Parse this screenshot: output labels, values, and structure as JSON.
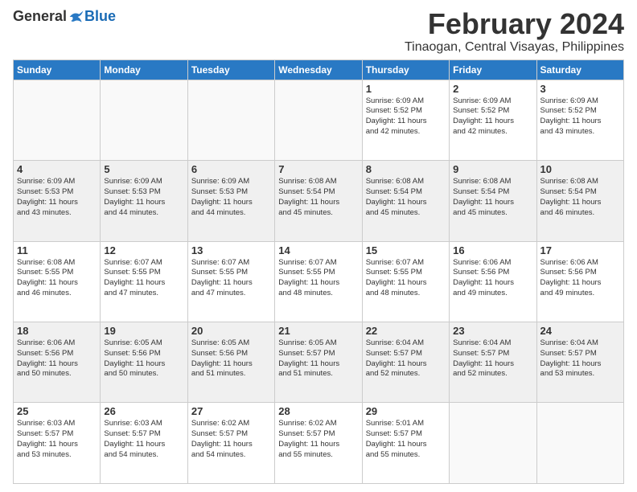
{
  "logo": {
    "general": "General",
    "blue": "Blue"
  },
  "title": "February 2024",
  "subtitle": "Tinaogan, Central Visayas, Philippines",
  "days_of_week": [
    "Sunday",
    "Monday",
    "Tuesday",
    "Wednesday",
    "Thursday",
    "Friday",
    "Saturday"
  ],
  "weeks": [
    [
      {
        "num": "",
        "info": ""
      },
      {
        "num": "",
        "info": ""
      },
      {
        "num": "",
        "info": ""
      },
      {
        "num": "",
        "info": ""
      },
      {
        "num": "1",
        "info": "Sunrise: 6:09 AM\nSunset: 5:52 PM\nDaylight: 11 hours\nand 42 minutes."
      },
      {
        "num": "2",
        "info": "Sunrise: 6:09 AM\nSunset: 5:52 PM\nDaylight: 11 hours\nand 42 minutes."
      },
      {
        "num": "3",
        "info": "Sunrise: 6:09 AM\nSunset: 5:52 PM\nDaylight: 11 hours\nand 43 minutes."
      }
    ],
    [
      {
        "num": "4",
        "info": "Sunrise: 6:09 AM\nSunset: 5:53 PM\nDaylight: 11 hours\nand 43 minutes."
      },
      {
        "num": "5",
        "info": "Sunrise: 6:09 AM\nSunset: 5:53 PM\nDaylight: 11 hours\nand 44 minutes."
      },
      {
        "num": "6",
        "info": "Sunrise: 6:09 AM\nSunset: 5:53 PM\nDaylight: 11 hours\nand 44 minutes."
      },
      {
        "num": "7",
        "info": "Sunrise: 6:08 AM\nSunset: 5:54 PM\nDaylight: 11 hours\nand 45 minutes."
      },
      {
        "num": "8",
        "info": "Sunrise: 6:08 AM\nSunset: 5:54 PM\nDaylight: 11 hours\nand 45 minutes."
      },
      {
        "num": "9",
        "info": "Sunrise: 6:08 AM\nSunset: 5:54 PM\nDaylight: 11 hours\nand 45 minutes."
      },
      {
        "num": "10",
        "info": "Sunrise: 6:08 AM\nSunset: 5:54 PM\nDaylight: 11 hours\nand 46 minutes."
      }
    ],
    [
      {
        "num": "11",
        "info": "Sunrise: 6:08 AM\nSunset: 5:55 PM\nDaylight: 11 hours\nand 46 minutes."
      },
      {
        "num": "12",
        "info": "Sunrise: 6:07 AM\nSunset: 5:55 PM\nDaylight: 11 hours\nand 47 minutes."
      },
      {
        "num": "13",
        "info": "Sunrise: 6:07 AM\nSunset: 5:55 PM\nDaylight: 11 hours\nand 47 minutes."
      },
      {
        "num": "14",
        "info": "Sunrise: 6:07 AM\nSunset: 5:55 PM\nDaylight: 11 hours\nand 48 minutes."
      },
      {
        "num": "15",
        "info": "Sunrise: 6:07 AM\nSunset: 5:55 PM\nDaylight: 11 hours\nand 48 minutes."
      },
      {
        "num": "16",
        "info": "Sunrise: 6:06 AM\nSunset: 5:56 PM\nDaylight: 11 hours\nand 49 minutes."
      },
      {
        "num": "17",
        "info": "Sunrise: 6:06 AM\nSunset: 5:56 PM\nDaylight: 11 hours\nand 49 minutes."
      }
    ],
    [
      {
        "num": "18",
        "info": "Sunrise: 6:06 AM\nSunset: 5:56 PM\nDaylight: 11 hours\nand 50 minutes."
      },
      {
        "num": "19",
        "info": "Sunrise: 6:05 AM\nSunset: 5:56 PM\nDaylight: 11 hours\nand 50 minutes."
      },
      {
        "num": "20",
        "info": "Sunrise: 6:05 AM\nSunset: 5:56 PM\nDaylight: 11 hours\nand 51 minutes."
      },
      {
        "num": "21",
        "info": "Sunrise: 6:05 AM\nSunset: 5:57 PM\nDaylight: 11 hours\nand 51 minutes."
      },
      {
        "num": "22",
        "info": "Sunrise: 6:04 AM\nSunset: 5:57 PM\nDaylight: 11 hours\nand 52 minutes."
      },
      {
        "num": "23",
        "info": "Sunrise: 6:04 AM\nSunset: 5:57 PM\nDaylight: 11 hours\nand 52 minutes."
      },
      {
        "num": "24",
        "info": "Sunrise: 6:04 AM\nSunset: 5:57 PM\nDaylight: 11 hours\nand 53 minutes."
      }
    ],
    [
      {
        "num": "25",
        "info": "Sunrise: 6:03 AM\nSunset: 5:57 PM\nDaylight: 11 hours\nand 53 minutes."
      },
      {
        "num": "26",
        "info": "Sunrise: 6:03 AM\nSunset: 5:57 PM\nDaylight: 11 hours\nand 54 minutes."
      },
      {
        "num": "27",
        "info": "Sunrise: 6:02 AM\nSunset: 5:57 PM\nDaylight: 11 hours\nand 54 minutes."
      },
      {
        "num": "28",
        "info": "Sunrise: 6:02 AM\nSunset: 5:57 PM\nDaylight: 11 hours\nand 55 minutes."
      },
      {
        "num": "29",
        "info": "Sunrise: 5:01 AM\nSunset: 5:57 PM\nDaylight: 11 hours\nand 55 minutes."
      },
      {
        "num": "",
        "info": ""
      },
      {
        "num": "",
        "info": ""
      }
    ]
  ]
}
